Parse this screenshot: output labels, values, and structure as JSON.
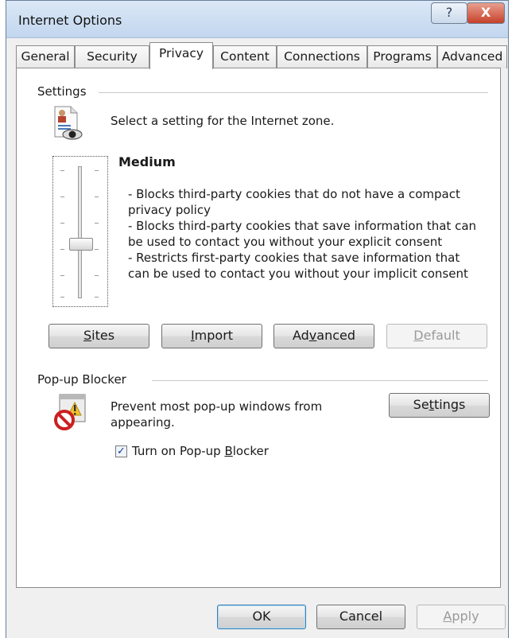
{
  "window": {
    "title": "Internet Options",
    "help_glyph": "?",
    "close_glyph": "X"
  },
  "tabs": [
    {
      "label": "General"
    },
    {
      "label": "Security"
    },
    {
      "label": "Privacy"
    },
    {
      "label": "Content"
    },
    {
      "label": "Connections"
    },
    {
      "label": "Programs"
    },
    {
      "label": "Advanced"
    }
  ],
  "active_tab": "Privacy",
  "settings": {
    "group_label": "Settings",
    "zone_text": "Select a setting for the Internet zone.",
    "level_title": "Medium",
    "description": [
      "- Blocks third-party cookies that do not have a compact",
      "privacy policy",
      "- Blocks third-party cookies that save information that can",
      "be used to contact you without your explicit consent",
      "- Restricts first-party cookies that save information that",
      "can be used to contact you without your implicit consent"
    ],
    "slider_level_index": 3,
    "slider_levels_total": 6,
    "buttons": {
      "sites": {
        "pre": "",
        "u": "S",
        "post": "ites"
      },
      "import": {
        "pre": "",
        "u": "I",
        "post": "mport"
      },
      "advanced": {
        "pre": "Ad",
        "u": "v",
        "post": "anced"
      },
      "default": {
        "pre": "",
        "u": "D",
        "post": "efault"
      }
    }
  },
  "popup": {
    "group_label": "Pop-up Blocker",
    "desc_line1": "Prevent most pop-up windows from",
    "desc_line2": "appearing.",
    "settings_button": {
      "pre": "Se",
      "u": "t",
      "post": "tings"
    },
    "checkbox": {
      "pre": "Turn on Pop-up ",
      "u": "B",
      "post": "locker",
      "checked": true
    }
  },
  "footer": {
    "ok": "OK",
    "cancel": "Cancel",
    "apply": {
      "pre": "",
      "u": "A",
      "post": "pply"
    }
  },
  "colors": {
    "title_bar": "#c2d6ee",
    "close_button": "#c6412b",
    "panel_bg": "#ffffff",
    "dialog_bg": "#f0f0f0"
  }
}
